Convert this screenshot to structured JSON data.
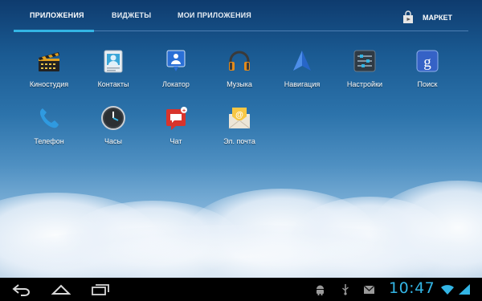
{
  "tabs": [
    {
      "label": "ПРИЛОЖЕНИЯ",
      "active": true
    },
    {
      "label": "ВИДЖЕТЫ",
      "active": false
    },
    {
      "label": "МОИ ПРИЛОЖЕНИЯ",
      "active": false
    }
  ],
  "market": {
    "label": "МАРКЕТ",
    "icon": "market-bag-icon"
  },
  "apps": [
    {
      "label": "Киностудия",
      "icon": "clapperboard-icon"
    },
    {
      "label": "Контакты",
      "icon": "contacts-card-icon"
    },
    {
      "label": "Локатор",
      "icon": "map-pin-icon"
    },
    {
      "label": "Музыка",
      "icon": "headphones-icon"
    },
    {
      "label": "Навигация",
      "icon": "navigation-arrow-icon"
    },
    {
      "label": "Настройки",
      "icon": "settings-sliders-icon"
    },
    {
      "label": "Поиск",
      "icon": "google-search-icon"
    },
    {
      "label": "Телефон",
      "icon": "phone-handset-icon"
    },
    {
      "label": "Часы",
      "icon": "clock-icon"
    },
    {
      "label": "Чат",
      "icon": "chat-bubble-icon"
    },
    {
      "label": "Эл. почта",
      "icon": "email-envelope-icon"
    }
  ],
  "status_bar": {
    "time": "10:47",
    "icons": [
      "android-debug-icon",
      "usb-icon",
      "gmail-icon",
      "wifi-icon",
      "signal-icon"
    ]
  },
  "nav_buttons": [
    "back-icon",
    "home-icon",
    "recent-apps-icon"
  ],
  "colors": {
    "accent": "#33b5e5",
    "bar": "#000000"
  }
}
